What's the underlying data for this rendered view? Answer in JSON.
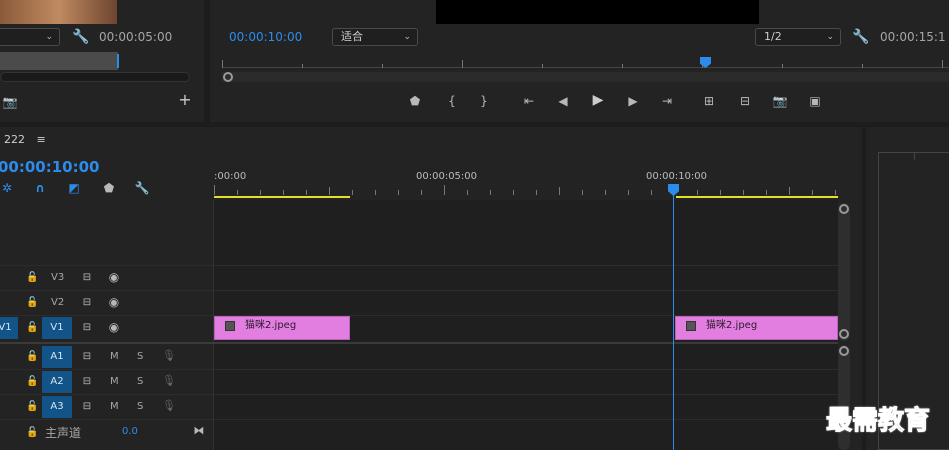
{
  "source_monitor": {
    "dropdown_value": "",
    "timecode": "00:00:05:00"
  },
  "program_monitor": {
    "current_timecode": "00:00:10:00",
    "fit_value": "适合",
    "resolution_value": "1/2",
    "duration_timecode": "00:00:15:1"
  },
  "timeline": {
    "sequence_name": "222",
    "current_timecode": "00:00:10:00",
    "ruler_labels": [
      ":00:00",
      "00:00:05:00",
      "00:00:10:00"
    ],
    "video_tracks": [
      {
        "name": "V3",
        "source": ""
      },
      {
        "name": "V2",
        "source": ""
      },
      {
        "name": "V1",
        "source": "V1"
      }
    ],
    "audio_tracks": [
      {
        "name": "A1",
        "mute": "M",
        "solo": "S"
      },
      {
        "name": "A2",
        "mute": "M",
        "solo": "S"
      },
      {
        "name": "A3",
        "mute": "M",
        "solo": "S"
      }
    ],
    "master": {
      "label": "主声道",
      "value": "0.0"
    },
    "clips": [
      {
        "label": "猫咪2.jpeg"
      },
      {
        "label": "猫咪2.jpeg"
      }
    ]
  },
  "watermark": "最需教育",
  "colors": {
    "accent_blue": "#2d8ceb",
    "clip_pink": "#e27ee0",
    "track_blue": "#125388",
    "work_area_yellow": "#e4df2a"
  }
}
